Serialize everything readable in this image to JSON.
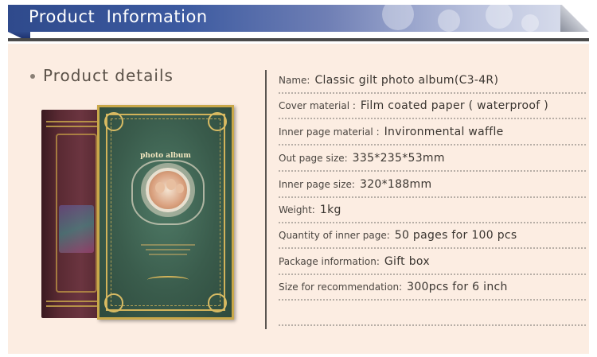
{
  "header": {
    "title": "Product  Information"
  },
  "section": {
    "title": "Product details"
  },
  "album_cover": {
    "title": "photo album"
  },
  "specs": [
    {
      "label": "Name:",
      "value": "Classic gilt photo album(C3-4R)"
    },
    {
      "label": "Cover material :",
      "value": "Film coated paper ( waterproof )"
    },
    {
      "label": "Inner page material :",
      "value": "Invironmental waffle"
    },
    {
      "label": "Out page size:",
      "value": "335*235*53mm"
    },
    {
      "label": "Inner page size:",
      "value": "320*188mm"
    },
    {
      "label": "Weight:",
      "value": "1kg"
    },
    {
      "label": "Quantity of inner page:",
      "value": "50 pages for 100 pcs"
    },
    {
      "label": "Package information:",
      "value": "Gift box"
    },
    {
      "label": "Size for recommendation:",
      "value": "300pcs for 6 inch"
    }
  ],
  "colors": {
    "header_blue": "#2f4a8c",
    "panel_bg": "#fcede2",
    "album_green": "#3a5c4c",
    "gold": "#c9a84a"
  }
}
